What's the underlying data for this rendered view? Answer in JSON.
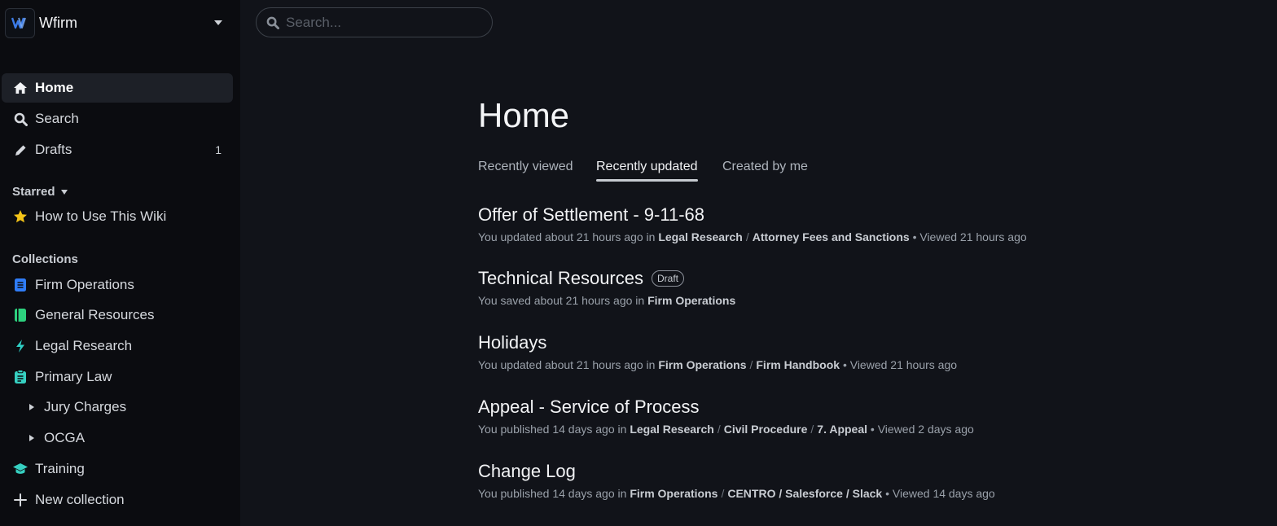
{
  "team": {
    "name": "Wfirm",
    "logo_text": "W"
  },
  "search": {
    "placeholder": "Search..."
  },
  "nav": {
    "home": "Home",
    "search": "Search",
    "drafts": "Drafts",
    "drafts_count": "1"
  },
  "starred": {
    "label": "Starred",
    "items": [
      {
        "label": "How to Use This Wiki",
        "icon": "star-icon",
        "color": "#f5c518"
      }
    ]
  },
  "collections": {
    "label": "Collections",
    "items": [
      {
        "label": "Firm Operations",
        "icon": "document-icon",
        "color": "#2f7cf6"
      },
      {
        "label": "General Resources",
        "icon": "book-icon",
        "color": "#2dd17e"
      },
      {
        "label": "Legal Research",
        "icon": "lightning-icon",
        "color": "#2fd0c6"
      },
      {
        "label": "Primary Law",
        "icon": "clipboard-icon",
        "color": "#36d0c1"
      },
      {
        "label": "Jury Charges",
        "icon": "triangle-right-icon",
        "nested": true
      },
      {
        "label": "OCGA",
        "icon": "triangle-right-icon",
        "nested": true
      },
      {
        "label": "Training",
        "icon": "graduation-cap-icon",
        "color": "#36d0c1"
      },
      {
        "label": "New collection",
        "icon": "plus-icon"
      }
    ]
  },
  "main": {
    "title": "Home",
    "tabs": [
      {
        "label": "Recently viewed",
        "active": false
      },
      {
        "label": "Recently updated",
        "active": true
      },
      {
        "label": "Created by me",
        "active": false
      }
    ],
    "documents": [
      {
        "title": "Offer of Settlement - 9-11-68",
        "badge": "",
        "action": "You updated about 21 hours ago in",
        "path": [
          "Legal Research",
          "Attorney Fees and Sanctions"
        ],
        "viewed": "• Viewed 21 hours ago"
      },
      {
        "title": "Technical Resources",
        "badge": "Draft",
        "action": "You saved about 21 hours ago in",
        "path": [
          "Firm Operations"
        ],
        "viewed": ""
      },
      {
        "title": "Holidays",
        "badge": "",
        "action": "You updated about 21 hours ago in",
        "path": [
          "Firm Operations",
          "Firm Handbook"
        ],
        "viewed": "• Viewed 21 hours ago"
      },
      {
        "title": "Appeal - Service of Process",
        "badge": "",
        "action": "You published 14 days ago in",
        "path": [
          "Legal Research",
          "Civil Procedure",
          "7. Appeal"
        ],
        "viewed": "• Viewed 2 days ago"
      },
      {
        "title": "Change Log",
        "badge": "",
        "action": "You published 14 days ago in",
        "path": [
          "Firm Operations",
          "CENTRO / Salesforce / Slack"
        ],
        "viewed": "• Viewed 14 days ago"
      }
    ]
  }
}
